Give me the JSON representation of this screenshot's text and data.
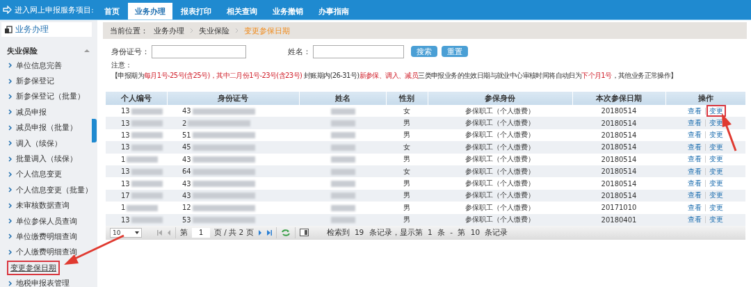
{
  "top_nav": {
    "title": "进入网上申报服务项目:",
    "tabs": [
      {
        "label": "首页",
        "selected": false
      },
      {
        "label": "业务办理",
        "selected": true
      },
      {
        "label": "报表打印",
        "selected": false
      },
      {
        "label": "相关查询",
        "selected": false
      },
      {
        "label": "业务撤销",
        "selected": false
      },
      {
        "label": "办事指南",
        "selected": false
      }
    ]
  },
  "sidebar": {
    "header": "业务办理",
    "section": {
      "title": "失业保险",
      "expanded": true,
      "items": [
        {
          "label": "单位信息完善",
          "selected": false
        },
        {
          "label": "新参保登记",
          "selected": false
        },
        {
          "label": "新参保登记（批量）",
          "selected": false
        },
        {
          "label": "减员申报",
          "selected": false
        },
        {
          "label": "减员申报（批量）",
          "selected": false
        },
        {
          "label": "调入（续保）",
          "selected": false
        },
        {
          "label": "批量调入（续保）",
          "selected": false
        },
        {
          "label": "个人信息变更",
          "selected": false
        },
        {
          "label": "个人信息变更（批量）",
          "selected": false
        },
        {
          "label": "未审核数据查询",
          "selected": false
        },
        {
          "label": "单位参保人员查询",
          "selected": false
        },
        {
          "label": "单位缴费明细查询",
          "selected": false
        },
        {
          "label": "个人缴费明细查询",
          "selected": false
        },
        {
          "label": "变更参保日期",
          "selected": true
        },
        {
          "label": "地税申报表管理",
          "selected": false
        }
      ]
    }
  },
  "breadcrumb": {
    "label": "当前位置：",
    "items": [
      "业务办理",
      "失业保险",
      "变更参保日期"
    ]
  },
  "search": {
    "fields": [
      {
        "label": "身份证号："
      },
      {
        "label": "姓名："
      }
    ],
    "buttons": [
      "搜索",
      "重置"
    ]
  },
  "notice": {
    "title": "注意：",
    "segments": [
      {
        "text": "【申报期为",
        "highlighted": false
      },
      {
        "text": "每月1号-25号(含25号)，其中二月份1号-23号(含23号)",
        "highlighted": true
      },
      {
        "text": " 封账期内(26-31号)",
        "highlighted": false
      },
      {
        "text": "新参保、调入、减员",
        "highlighted": true
      },
      {
        "text": "三类申报业务的生效日期与就业中心审核时间将自动归为",
        "highlighted": false
      },
      {
        "text": "下个月1号",
        "highlighted": true
      },
      {
        "text": "，其他业务正常操作】",
        "highlighted": false
      }
    ]
  },
  "table": {
    "columns": [
      "个人编号",
      "身份证号",
      "姓名",
      "性别",
      "参保身份",
      "本次参保日期",
      "操作"
    ],
    "rows": [
      {
        "id_prefix": "13",
        "idcard_prefix": "43",
        "gender": "女",
        "identity": "参保职工（个人缴费）",
        "date": "20180514",
        "actions": [
          {
            "label": "查看",
            "highlighted": false
          },
          {
            "label": "变更",
            "highlighted": true
          }
        ]
      },
      {
        "id_prefix": "13",
        "idcard_prefix": "2",
        "gender": "男",
        "identity": "参保职工（个人缴费）",
        "date": "20180514",
        "actions": [
          {
            "label": "查看",
            "highlighted": false
          },
          {
            "label": "变更",
            "highlighted": false
          }
        ]
      },
      {
        "id_prefix": "13",
        "idcard_prefix": "51",
        "gender": "男",
        "identity": "参保职工（个人缴费）",
        "date": "20180514",
        "actions": [
          {
            "label": "查看",
            "highlighted": false
          },
          {
            "label": "变更",
            "highlighted": false
          }
        ]
      },
      {
        "id_prefix": "13",
        "idcard_prefix": "45",
        "gender": "女",
        "identity": "参保职工（个人缴费）",
        "date": "20180514",
        "actions": [
          {
            "label": "查看",
            "highlighted": false
          },
          {
            "label": "变更",
            "highlighted": false
          }
        ]
      },
      {
        "id_prefix": "1",
        "idcard_prefix": "43",
        "gender": "男",
        "identity": "参保职工（个人缴费）",
        "date": "20180514",
        "actions": [
          {
            "label": "查看",
            "highlighted": false
          },
          {
            "label": "变更",
            "highlighted": false
          }
        ]
      },
      {
        "id_prefix": "13",
        "idcard_prefix": "64",
        "gender": "女",
        "identity": "参保职工（个人缴费）",
        "date": "20180514",
        "actions": [
          {
            "label": "查看",
            "highlighted": false
          },
          {
            "label": "变更",
            "highlighted": false
          }
        ]
      },
      {
        "id_prefix": "13",
        "idcard_prefix": "43",
        "gender": "男",
        "identity": "参保职工（个人缴费）",
        "date": "20180514",
        "actions": [
          {
            "label": "查看",
            "highlighted": false
          },
          {
            "label": "变更",
            "highlighted": false
          }
        ]
      },
      {
        "id_prefix": "17",
        "idcard_prefix": "43",
        "gender": "男",
        "identity": "参保职工（个人缴费）",
        "date": "20180514",
        "actions": [
          {
            "label": "查看",
            "highlighted": false
          },
          {
            "label": "变更",
            "highlighted": false
          }
        ]
      },
      {
        "id_prefix": "1",
        "idcard_prefix": "12",
        "gender": "男",
        "identity": "参保职工（个人缴费）",
        "date": "20171010",
        "actions": [
          {
            "label": "查看",
            "highlighted": false
          },
          {
            "label": "变更",
            "highlighted": false
          }
        ]
      },
      {
        "id_prefix": "13",
        "idcard_prefix": "53",
        "gender": "男",
        "identity": "参保职工（个人缴费）",
        "date": "20180401",
        "actions": [
          {
            "label": "查看",
            "highlighted": false
          },
          {
            "label": "变更",
            "highlighted": false
          }
        ]
      }
    ]
  },
  "pager": {
    "page_size": "10",
    "page_before": "第",
    "page": "1",
    "page_after": "页 / 共 2 页",
    "summary": "检索到 19 条记录，显示第 1 条 - 第 10 条记录"
  }
}
